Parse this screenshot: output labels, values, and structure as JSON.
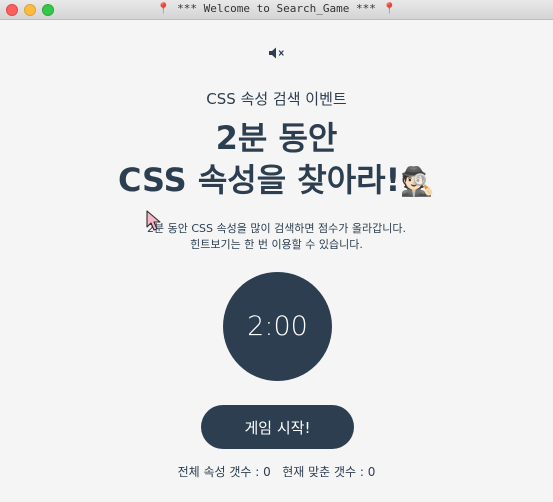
{
  "window": {
    "title_pin": "📍",
    "title": "*** Welcome to Search_Game ***",
    "controls": [
      "close",
      "minimize",
      "zoom"
    ]
  },
  "icons": {
    "sound": "speaker-muted-icon",
    "cursor": "mouse-pointer-icon",
    "detective": "detective-emoji"
  },
  "header": {
    "subtitle": "CSS 속성 검색 이벤트",
    "headline_line1": "2분 동안",
    "headline_line2": "CSS 속성을 찾아라!",
    "headline_emoji": "🕵🏻"
  },
  "instructions": {
    "line1": "2분 동안 CSS 속성을 많이 검색하면 점수가 올라갑니다.",
    "line2": "힌트보기는 한 번 이용할 수 있습니다."
  },
  "timer": {
    "value": "2:00"
  },
  "actions": {
    "start_label": "게임 시작!"
  },
  "stats": {
    "total_label": "전체 속성 갯수 :",
    "total_value": "0",
    "found_label": "현재 맞춘 갯수 :",
    "found_value": "0"
  },
  "colors": {
    "primary": "#2c3e50",
    "background": "#f5f5f5",
    "close": "#fc605c",
    "minimize": "#fdbc40",
    "zoom": "#34c84a"
  }
}
